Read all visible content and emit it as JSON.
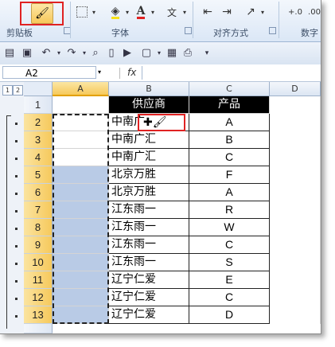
{
  "ribbon": {
    "groups": [
      {
        "label": "剪贴板"
      },
      {
        "label": "字体"
      },
      {
        "label": "对齐方式"
      },
      {
        "label": "数字"
      }
    ],
    "font_color_accent": "#e02222",
    "highlight_accent": "#f6e11a",
    "format_painter_icon": "paintbrush-icon"
  },
  "formula_bar": {
    "name_box": "A2",
    "fx_label": "fx",
    "formula": ""
  },
  "outline": {
    "levels": [
      "1",
      "2"
    ]
  },
  "columns": [
    "A",
    "B",
    "C",
    "D"
  ],
  "rows": [
    "1",
    "2",
    "3",
    "4",
    "5",
    "6",
    "7",
    "8",
    "9",
    "10",
    "11",
    "12",
    "13"
  ],
  "table": {
    "headers": [
      "供应商",
      "产品"
    ],
    "data": [
      [
        "中南广",
        "A"
      ],
      [
        "中南广汇",
        "B"
      ],
      [
        "中南广汇",
        "C"
      ],
      [
        "北京万胜",
        "F"
      ],
      [
        "北京万胜",
        "A"
      ],
      [
        "江东雨一",
        "R"
      ],
      [
        "江东雨一",
        "W"
      ],
      [
        "江东雨一",
        "C"
      ],
      [
        "江东雨一",
        "S"
      ],
      [
        "辽宁仁爱",
        "E"
      ],
      [
        "辽宁仁爱",
        "C"
      ],
      [
        "辽宁仁爱",
        "D"
      ]
    ]
  },
  "colors": {
    "selected_header": "#f6c95c",
    "selection_fill": "#b9cbe6",
    "highlight_box": "#e02222",
    "header_fill": "#000000"
  }
}
